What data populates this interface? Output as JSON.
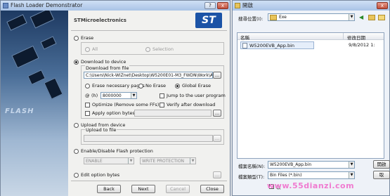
{
  "left_window": {
    "title": "Flash Loader Demonstrator",
    "company": "STMicroelectronics",
    "logo_text": "ST",
    "sidebar_text": "FLASH",
    "erase": {
      "label": "Erase",
      "all": "All",
      "selection": "Selection"
    },
    "download": {
      "label": "Download to device",
      "from_file_label": "Download from file",
      "file_path": "C:\\Users\\Nick-WIZnet\\Desktop\\W5200E01-M3_FWDN\\Work\\App",
      "browse": "...",
      "erase_necessary": "Erase necessary pages",
      "no_erase": "No Erase",
      "global_erase": "Global Erase",
      "at_prefix": "@",
      "hex_prefix": "(h)",
      "address": "8000000",
      "jump": "Jump to the user program",
      "optimize": "Optimize (Remove some FFs)",
      "verify": "Verify after download",
      "apply_option": "Apply option bytes",
      "option_browse": "..."
    },
    "upload": {
      "label": "Upload from device",
      "to_file_label": "Upload to file",
      "browse": "..."
    },
    "protection": {
      "label": "Enable/Disable Flash protection",
      "state": "ENABLE",
      "type": "WRITE PROTECTION"
    },
    "edit_option": {
      "label": "Edit option bytes",
      "browse": "..."
    },
    "buttons": {
      "back": "Back",
      "next": "Next",
      "cancel": "Cancel",
      "close": "Close"
    },
    "title_buttons": {
      "help": "?",
      "close": "x"
    }
  },
  "right_window": {
    "title": "開啟",
    "look_in_label": "搜尋位置(I):",
    "look_in_value": "Exe",
    "col_name": "名稱",
    "col_date": "修改日期",
    "file_name": "W5200EVB_App.bin",
    "file_date": "9/8/2012 1:",
    "filename_label": "檔案名稱(N):",
    "filename_value": "W5200EVB_App.bin",
    "filetype_label": "檔案類型(T):",
    "filetype_value": "Bin Files (*.bin)",
    "open_button": "開啟",
    "cancel_button": "取",
    "readonly_label": "以",
    "close_button": "x"
  },
  "watermark": "www.55dianzi.com"
}
